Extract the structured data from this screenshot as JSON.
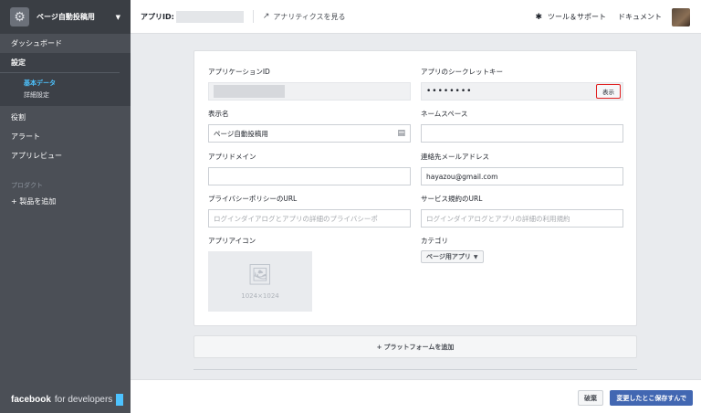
{
  "sidebar": {
    "app_name": "ページ自動投稿用",
    "items_top": [
      {
        "label": "ダッシュボード"
      }
    ],
    "settings": {
      "title": "設定",
      "subitems": [
        {
          "label": "基本データ"
        },
        {
          "label": "詳細設定"
        }
      ]
    },
    "items": [
      {
        "label": "役割"
      },
      {
        "label": "アラート"
      },
      {
        "label": "アプリレビュー"
      }
    ],
    "products_section": "プロダクト",
    "add_product": "+ 製品を追加",
    "footer": {
      "brand": "facebook",
      "suffix": "for developers"
    }
  },
  "topbar": {
    "app_id_label": "アプリID:",
    "analytics_label": "アナリティクスを見る",
    "tools_label": "ツール＆サポート",
    "docs_label": "ドキュメント"
  },
  "form": {
    "app_id": {
      "label": "アプリケーションID"
    },
    "app_secret": {
      "label": "アプリのシークレットキー",
      "value": "••••••••",
      "show_label": "表示"
    },
    "display_name": {
      "label": "表示名",
      "value": "ページ自動投稿用"
    },
    "namespace": {
      "label": "ネームスペース",
      "value": ""
    },
    "app_domain": {
      "label": "アプリドメイン",
      "value": ""
    },
    "contact_email": {
      "label": "連絡先メールアドレス",
      "value": "hayazou@gmail.com"
    },
    "privacy_url": {
      "label": "プライバシーポリシーのURL",
      "placeholder": "ログインダイアログとアプリの詳細のプライバシーポ"
    },
    "terms_url": {
      "label": "サービス規約のURL",
      "placeholder": "ログインダイアログとアプリの詳細の利用規約"
    },
    "app_icon": {
      "label": "アプリアイコン",
      "dimensions": "1024×1024"
    },
    "category": {
      "label": "カテゴリ",
      "value": "ページ用アプリ"
    }
  },
  "add_platform": "プラットフォームを追加",
  "footer": {
    "discard": "破棄",
    "save": "変更したとこ保存すんで"
  },
  "colors": {
    "sidebar": "#4b4f56",
    "accent": "#4267b2",
    "active_link": "#4dc3ff",
    "highlight": "#e02020"
  }
}
